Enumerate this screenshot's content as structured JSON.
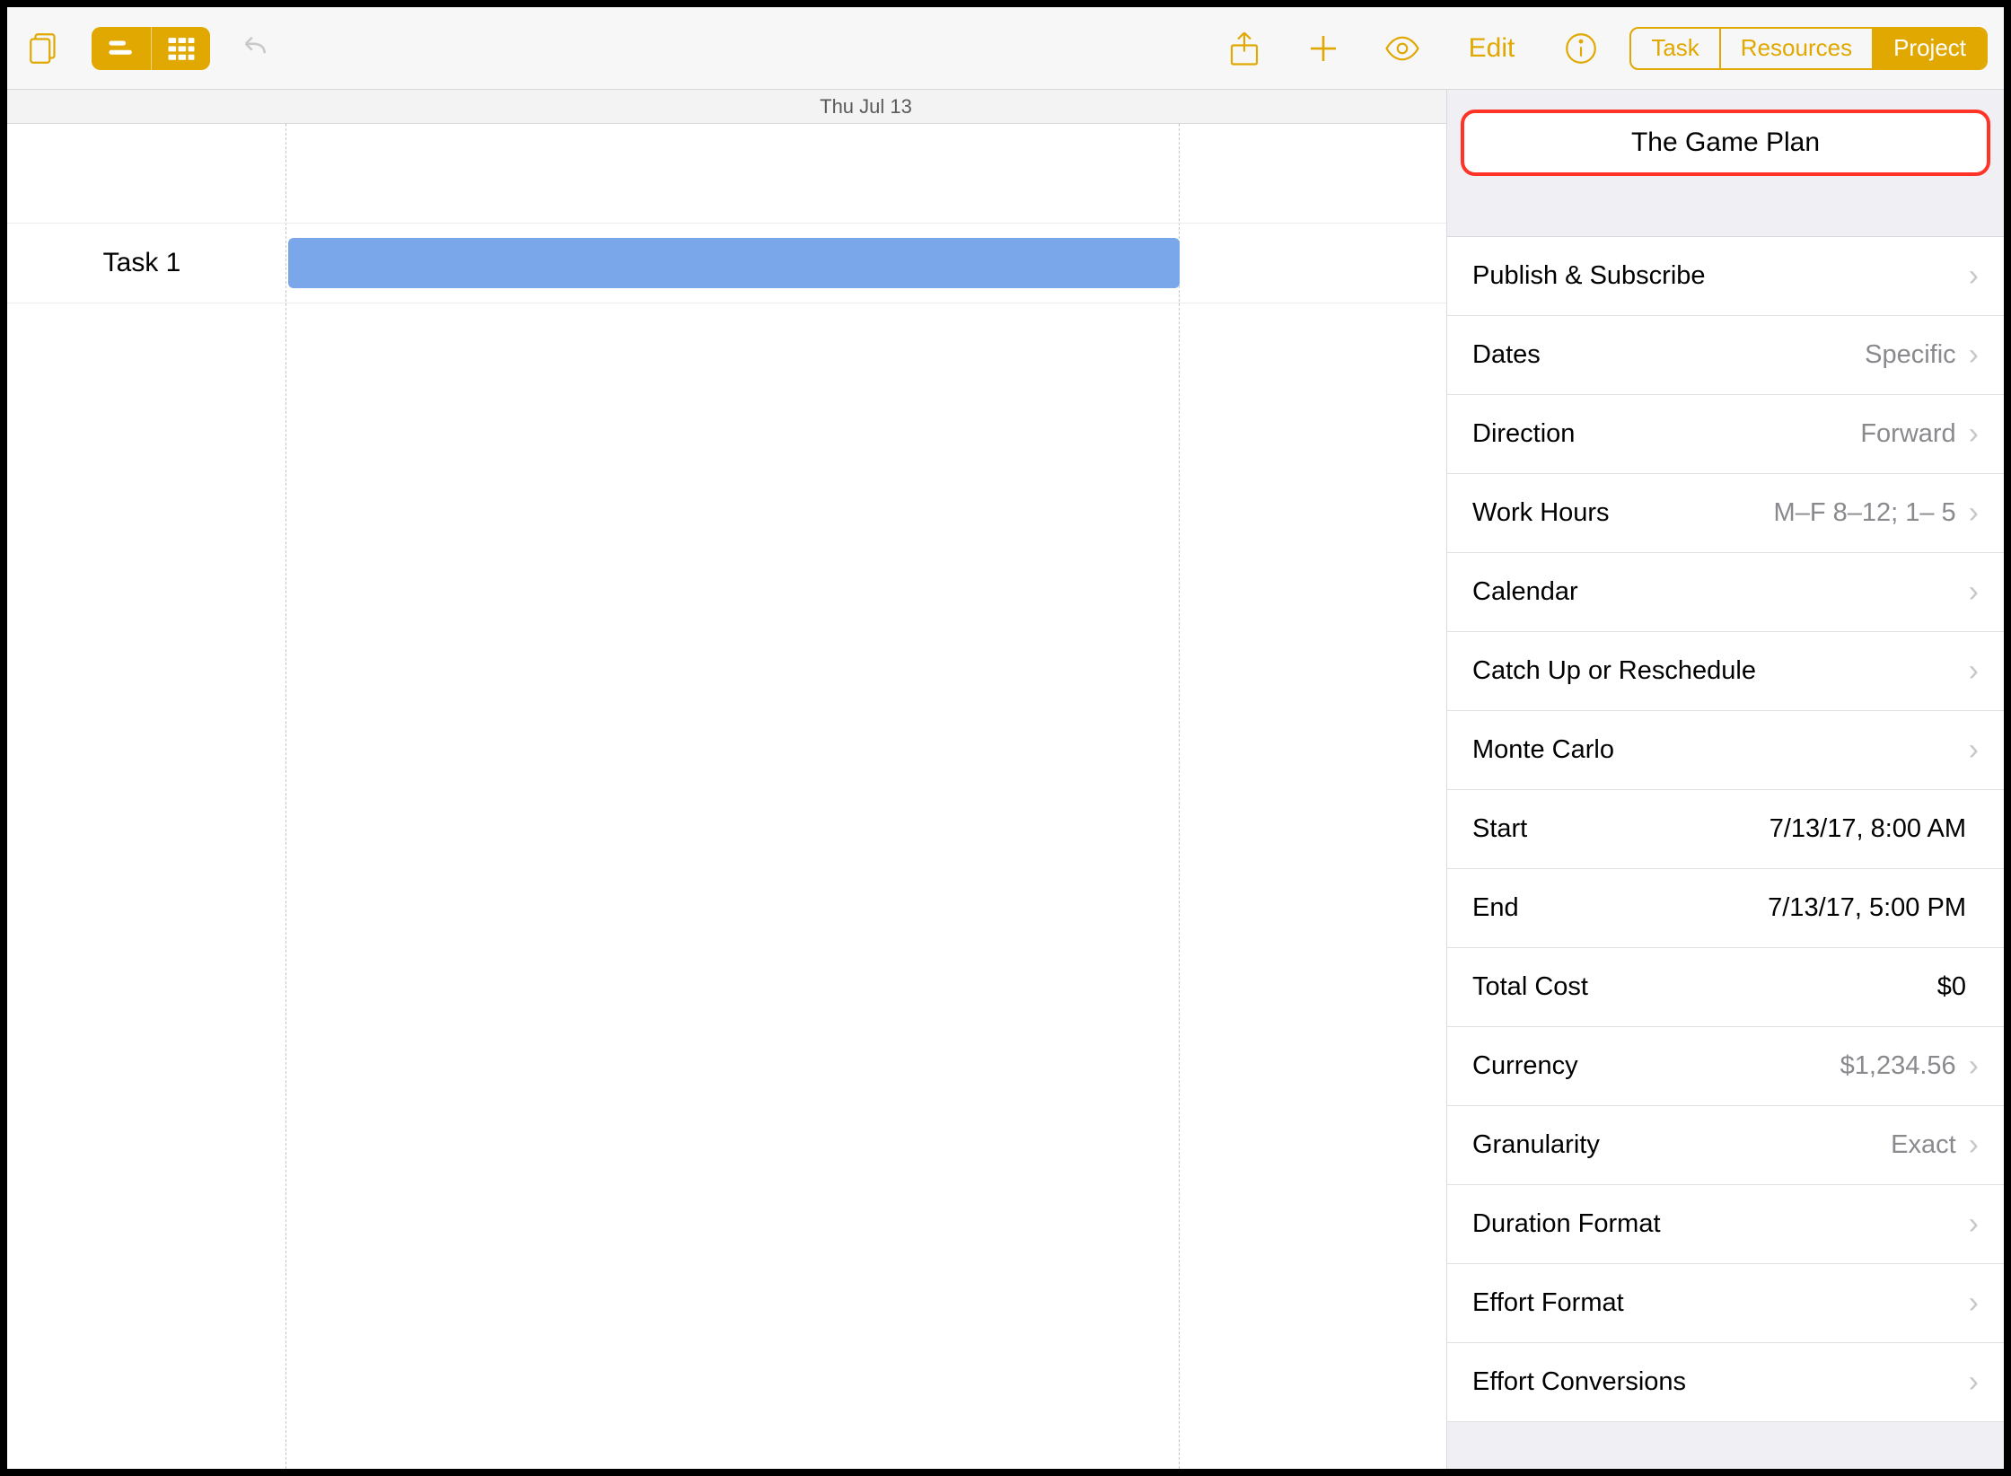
{
  "toolbar": {
    "edit_label": "Edit"
  },
  "tabs": {
    "task": "Task",
    "resources": "Resources",
    "project": "Project",
    "active": "project"
  },
  "gantt": {
    "date_header": "Thu Jul 13",
    "tasks": [
      {
        "name": "Task 1"
      }
    ]
  },
  "inspector": {
    "project_title": "The Game Plan",
    "rows": {
      "publish_subscribe": {
        "label": "Publish & Subscribe",
        "value": ""
      },
      "dates": {
        "label": "Dates",
        "value": "Specific"
      },
      "direction": {
        "label": "Direction",
        "value": "Forward"
      },
      "work_hours": {
        "label": "Work Hours",
        "value": "M–F  8–12; 1– 5"
      },
      "calendar": {
        "label": "Calendar",
        "value": ""
      },
      "catch_up": {
        "label": "Catch Up or Reschedule",
        "value": ""
      },
      "monte_carlo": {
        "label": "Monte Carlo",
        "value": ""
      },
      "start": {
        "label": "Start",
        "value": "7/13/17, 8:00 AM"
      },
      "end": {
        "label": "End",
        "value": "7/13/17, 5:00 PM"
      },
      "total_cost": {
        "label": "Total Cost",
        "value": "$0"
      },
      "currency": {
        "label": "Currency",
        "value": "$1,234.56"
      },
      "granularity": {
        "label": "Granularity",
        "value": "Exact"
      },
      "duration_format": {
        "label": "Duration Format",
        "value": ""
      },
      "effort_format": {
        "label": "Effort Format",
        "value": ""
      },
      "effort_conversions": {
        "label": "Effort Conversions",
        "value": ""
      }
    }
  }
}
